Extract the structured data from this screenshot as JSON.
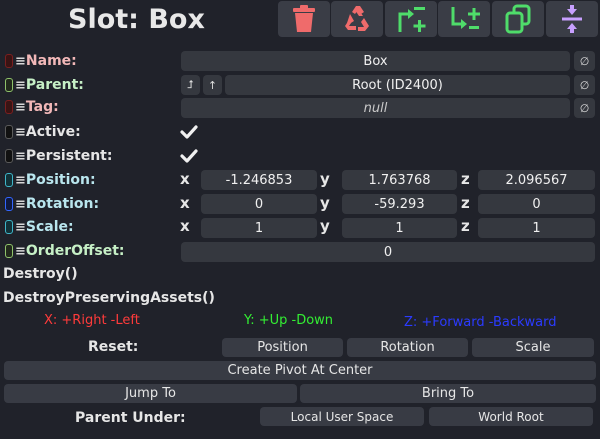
{
  "header": {
    "title": "Slot: Box",
    "toolbar": [
      {
        "name": "delete-button",
        "icon": "trash-icon",
        "color": "#ef6b6b"
      },
      {
        "name": "destroy-preserving-button",
        "icon": "recycle-icon",
        "color": "#ef6b6b"
      },
      {
        "name": "insert-parent-button",
        "icon": "insert-parent-icon",
        "color": "#4fdc6a"
      },
      {
        "name": "add-child-button",
        "icon": "add-child-icon",
        "color": "#4fdc6a"
      },
      {
        "name": "duplicate-button",
        "icon": "duplicate-icon",
        "color": "#4fdc6a"
      },
      {
        "name": "collapse-button",
        "icon": "collapse-icon",
        "color": "#c8a0ff"
      }
    ]
  },
  "fields": {
    "name": {
      "label": "Name:",
      "value": "Box",
      "null_btn": "∅"
    },
    "parent": {
      "label": "Parent:",
      "value": "Root (ID2400)",
      "null_btn": "∅",
      "btn1": "⮥",
      "btn2": "↑"
    },
    "tag": {
      "label": "Tag:",
      "value": "null",
      "null_btn": "∅"
    },
    "active": {
      "label": "Active:",
      "checked": true
    },
    "persistent": {
      "label": "Persistent:",
      "checked": true
    },
    "position": {
      "label": "Position:",
      "x": "-1.246853",
      "y": "1.763768",
      "z": "2.096567"
    },
    "rotation": {
      "label": "Rotation:",
      "x": "0",
      "y": "-59.293",
      "z": "0"
    },
    "scale": {
      "label": "Scale:",
      "x": "1",
      "y": "1",
      "z": "1"
    },
    "order_offset": {
      "label": "OrderOffset:",
      "value": "0"
    }
  },
  "axes": {
    "x": "x",
    "y": "y",
    "z": "z"
  },
  "methods": {
    "destroy": "Destroy()",
    "destroy_preserving": "DestroyPreservingAssets()"
  },
  "legend": {
    "x": "X: +Right -Left",
    "y": "Y: +Up -Down",
    "z": "Z: +Forward -Backward",
    "colors": {
      "x": "#ff3b3b",
      "y": "#33ee33",
      "z": "#2b3bff"
    }
  },
  "reset": {
    "label": "Reset:",
    "position": "Position",
    "rotation": "Rotation",
    "scale": "Scale"
  },
  "actions": {
    "create_pivot": "Create Pivot At Center",
    "jump_to": "Jump To",
    "bring_to": "Bring To",
    "parent_under": "Parent Under:",
    "local_user_space": "Local User Space",
    "world_root": "World Root"
  },
  "colors": {
    "text_red": "#f2b8b8",
    "text_green": "#c6f0c6",
    "text_cyan": "#b9e6ee",
    "swatch_red": "#7a1f1f",
    "swatch_green": "#8fc26a",
    "swatch_black": "#5a5a5a",
    "swatch_cyan": "#3fb6c9",
    "swatch_blue": "#3266ff"
  }
}
